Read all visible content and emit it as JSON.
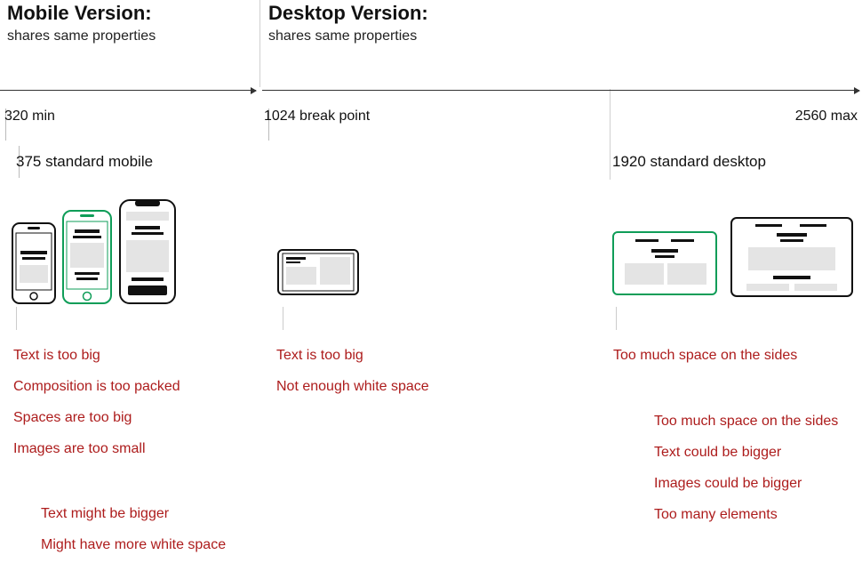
{
  "sections": {
    "mobile": {
      "title": "Mobile Version:",
      "subtitle": "shares same properties"
    },
    "desktop": {
      "title": "Desktop Version:",
      "subtitle": "shares same properties"
    }
  },
  "axis": {
    "min": "320 min",
    "breakpoint": "1024 break point",
    "max": "2560 max",
    "std_mobile": "375 standard mobile",
    "std_desktop": "1920 standard desktop"
  },
  "issues": {
    "mobile_small": [
      "Text is too big",
      "Composition is too packed",
      "Spaces are too big",
      "Images are too small"
    ],
    "mobile_large": [
      "Text might be bigger",
      "Might have more white space"
    ],
    "desktop_small": [
      "Text is too big",
      "Not enough white space"
    ],
    "desktop_std": [
      "Too much space on the sides"
    ],
    "desktop_large": [
      "Too much space on the sides",
      "Text could be bigger",
      "Images could be bigger",
      "Too many elements"
    ]
  },
  "icons": {
    "phone_small": "phone-small-icon",
    "phone_std": "phone-std-icon",
    "phone_large": "phone-large-icon",
    "tablet": "tablet-icon",
    "laptop_std": "laptop-std-icon",
    "laptop_large": "laptop-large-icon"
  },
  "colors": {
    "accent": "#0F9D58",
    "issue": "#AD1C1C"
  }
}
